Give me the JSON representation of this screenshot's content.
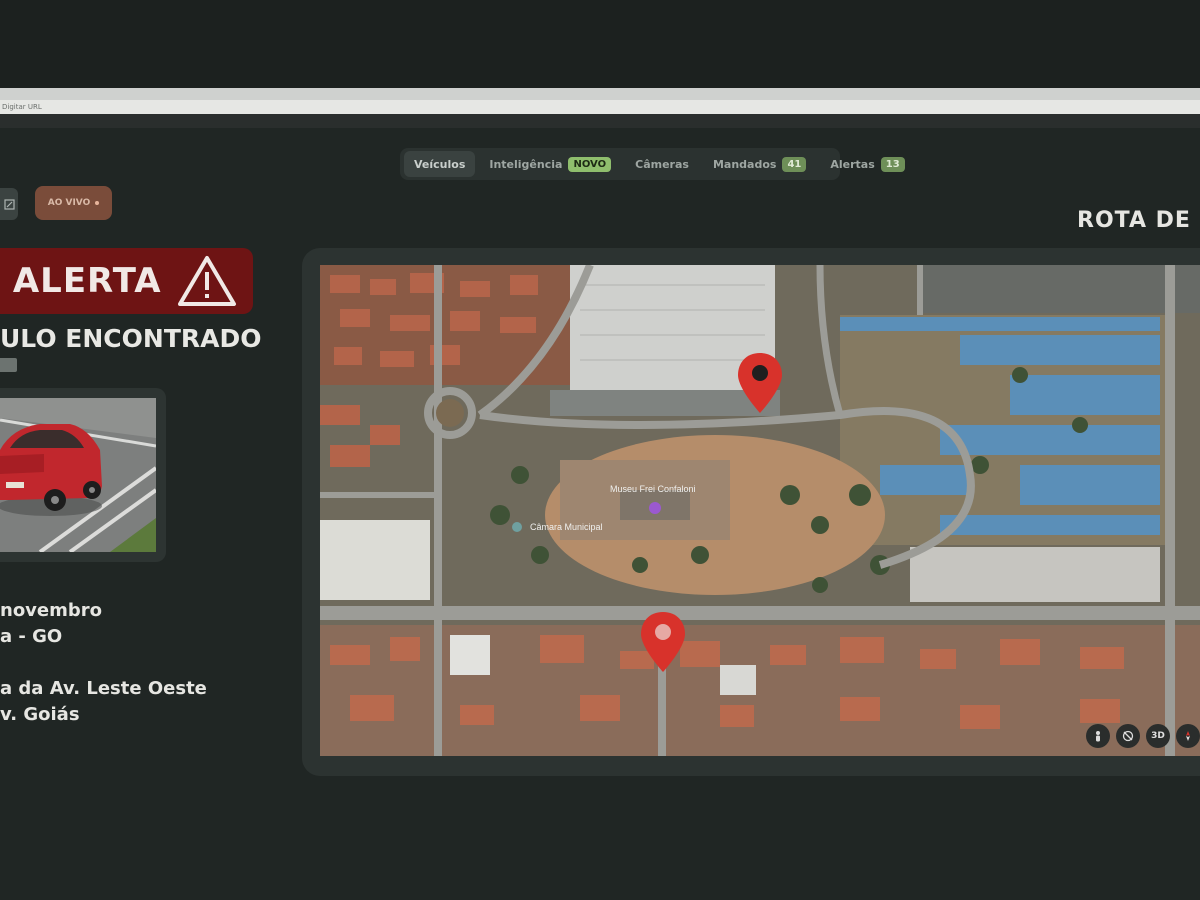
{
  "browser": {
    "url_placeholder": "Digitar URL"
  },
  "nav": {
    "items": [
      {
        "label": "Veículos"
      },
      {
        "label": "Inteligência",
        "badge": "NOVO"
      },
      {
        "label": "Câmeras"
      },
      {
        "label": "Mandados",
        "badge": "41"
      },
      {
        "label": "Alertas",
        "badge": "13"
      }
    ],
    "active_index": 0
  },
  "controls": {
    "live_label": "AO VIVO",
    "edit_icon": "edit-icon"
  },
  "alert": {
    "label": "ALERTA",
    "title": "ULO ENCONTRADO",
    "icon": "warning-triangle-icon"
  },
  "vehicle": {
    "color": "#c1272d"
  },
  "info": {
    "line1": "novembro",
    "line2": "a - GO",
    "line3": "a da Av. Leste Oeste",
    "line4": "v. Goiás"
  },
  "map": {
    "title": "ROTA DE I",
    "label_museum": "Museu Frei Confaloni",
    "label_camara": "Câmara Municipal",
    "controls": [
      "person-icon",
      "compass-off-icon",
      "3D",
      "compass-icon"
    ],
    "pin_color": "#d8322b"
  }
}
